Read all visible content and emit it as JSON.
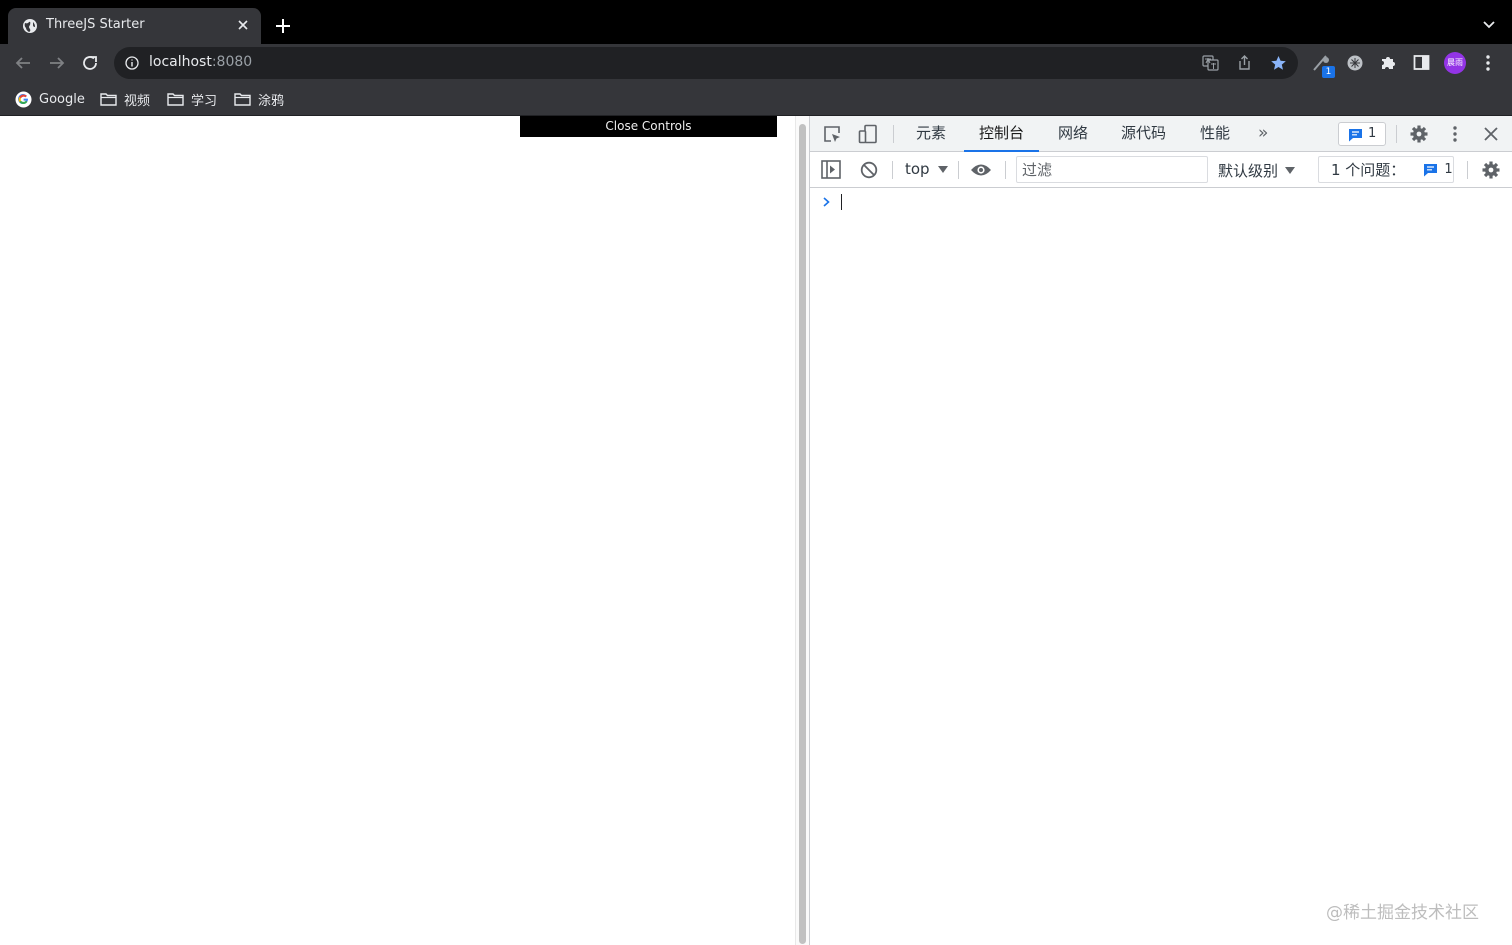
{
  "tab": {
    "title": "ThreeJS Starter",
    "favicon": "globe-icon"
  },
  "address": {
    "host": "localhost",
    "port": ":8080"
  },
  "profile": {
    "initials": "晨雨",
    "color": "#9334e6"
  },
  "extensions": {
    "badge": "1"
  },
  "bookmarks": [
    {
      "label": "Google",
      "icon": "google-icon"
    },
    {
      "label": "视频",
      "icon": "folder-icon"
    },
    {
      "label": "学习",
      "icon": "folder-icon"
    },
    {
      "label": "涂鸦",
      "icon": "folder-icon"
    }
  ],
  "page": {
    "close_controls": "Close Controls"
  },
  "devtools": {
    "tabs": [
      {
        "label": "元素"
      },
      {
        "label": "控制台",
        "active": true
      },
      {
        "label": "网络"
      },
      {
        "label": "源代码"
      },
      {
        "label": "性能"
      }
    ],
    "more": "»",
    "issue_count": "1",
    "context": "top",
    "filter_placeholder": "过滤",
    "level": "默认级别",
    "issues_label": "1 个问题：",
    "issues_count": "1",
    "accent": "#1a73e8"
  },
  "watermark": "@稀土掘金技术社区"
}
